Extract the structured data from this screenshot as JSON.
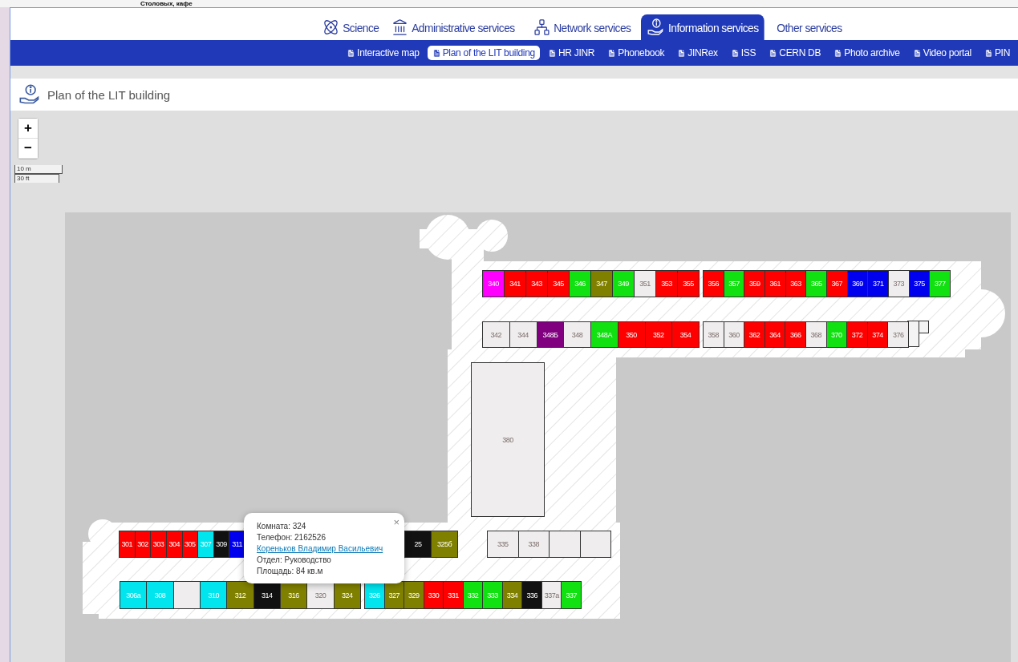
{
  "background": {
    "text": "Столовых, кафе"
  },
  "tabs": [
    {
      "label": "Science",
      "kind": "atom",
      "selected": false
    },
    {
      "label": "Administrative services",
      "kind": "building",
      "selected": false
    },
    {
      "label": "Network services",
      "kind": "network",
      "selected": false
    },
    {
      "label": "Information services",
      "kind": "info",
      "selected": true
    },
    {
      "label": "Other services",
      "selected": false
    }
  ],
  "subnav": [
    {
      "label": "Interactive map",
      "selected": false
    },
    {
      "label": "Plan of the LIT building",
      "selected": true
    },
    {
      "label": "HR JINR",
      "selected": false
    },
    {
      "label": "Phonebook",
      "selected": false
    },
    {
      "label": "JINRex",
      "selected": false
    },
    {
      "label": "ISS",
      "selected": false
    },
    {
      "label": "CERN DB",
      "selected": false
    },
    {
      "label": "Photo archive",
      "selected": false
    },
    {
      "label": "Video portal",
      "selected": false
    },
    {
      "label": "PIN",
      "selected": false
    }
  ],
  "page_title": "Plan of the LIT building",
  "map": {
    "zoom_in": "+",
    "zoom_out": "−",
    "scale": [
      "10 m",
      "30 ft"
    ],
    "blocks": [
      {
        "rooms": [
          {
            "label": "340",
            "color": "#ff00ff"
          },
          {
            "label": "341",
            "color": "#ff0000"
          },
          {
            "label": "343",
            "color": "#ff0000"
          },
          {
            "label": "345",
            "color": "#ff0000"
          },
          {
            "label": "346",
            "color": "#11e011"
          },
          {
            "label": "347",
            "color": "#808000"
          },
          {
            "label": "349",
            "color": "#11e011"
          },
          {
            "label": "351",
            "color": "#efeded"
          },
          {
            "label": "353",
            "color": "#ff0000"
          },
          {
            "label": "355",
            "color": "#ff0000"
          }
        ]
      },
      {
        "rooms": [
          {
            "label": "356",
            "color": "#ff0000"
          },
          {
            "label": "357",
            "color": "#11e011"
          },
          {
            "label": "359",
            "color": "#ff0000"
          },
          {
            "label": "361",
            "color": "#ff0000"
          },
          {
            "label": "363",
            "color": "#ff0000"
          },
          {
            "label": "365",
            "color": "#11e011"
          },
          {
            "label": "367",
            "color": "#ff0000"
          },
          {
            "label": "369",
            "color": "#0000ee"
          },
          {
            "label": "371",
            "color": "#0000ee"
          },
          {
            "label": "373",
            "color": "#efeded"
          },
          {
            "label": "375",
            "color": "#0000ee"
          },
          {
            "label": "377",
            "color": "#11e011"
          }
        ]
      },
      {
        "rooms": [
          {
            "label": "342",
            "color": "#efeded"
          },
          {
            "label": "344",
            "color": "#efeded"
          },
          {
            "label": "348Б",
            "color": "#800080"
          },
          {
            "label": "348",
            "color": "#efeded"
          },
          {
            "label": "348А",
            "color": "#11e011"
          },
          {
            "label": "350",
            "color": "#ff0000"
          },
          {
            "label": "352",
            "color": "#ff0000"
          },
          {
            "label": "354",
            "color": "#ff0000"
          }
        ]
      },
      {
        "rooms": [
          {
            "label": "358",
            "color": "#efeded"
          },
          {
            "label": "360",
            "color": "#efeded"
          },
          {
            "label": "362",
            "color": "#ff0000"
          },
          {
            "label": "364",
            "color": "#ff0000"
          },
          {
            "label": "366",
            "color": "#ff0000"
          },
          {
            "label": "368",
            "color": "#efeded"
          },
          {
            "label": "370",
            "color": "#11e011"
          },
          {
            "label": "372",
            "color": "#ff0000"
          },
          {
            "label": "374",
            "color": "#ff0000"
          },
          {
            "label": "376",
            "color": "#efeded"
          }
        ]
      },
      {
        "rooms": [
          {
            "label": "380",
            "color": "#efeded"
          }
        ]
      },
      {
        "rooms": [
          {
            "label": "301",
            "color": "#ff0000"
          },
          {
            "label": "302",
            "color": "#ff0000"
          },
          {
            "label": "303",
            "color": "#ff0000"
          },
          {
            "label": "304",
            "color": "#ff0000"
          },
          {
            "label": "305",
            "color": "#ff0000"
          },
          {
            "label": "307",
            "color": "#00e5ee"
          },
          {
            "label": "309",
            "color": "#111111"
          },
          {
            "label": "311",
            "color": "#0000ee"
          }
        ]
      },
      {
        "rooms": [
          {
            "label": "25",
            "color": "#111111"
          },
          {
            "label": "325б",
            "color": "#808000"
          }
        ]
      },
      {
        "rooms": [
          {
            "label": "335",
            "color": "#efeded"
          },
          {
            "label": "338",
            "color": "#efeded"
          },
          {
            "color": "#efeded"
          },
          {
            "color": "#efeded"
          }
        ]
      },
      {
        "rooms": [
          {
            "label": "306а",
            "color": "#00e5ee"
          },
          {
            "label": "308",
            "color": "#00e5ee"
          },
          {
            "color": "#efeded"
          },
          {
            "label": "310",
            "color": "#00e5ee"
          },
          {
            "label": "312",
            "color": "#808000"
          },
          {
            "label": "314",
            "color": "#111111"
          },
          {
            "label": "316",
            "color": "#808000"
          },
          {
            "label": "320",
            "color": "#efeded"
          },
          {
            "label": "324",
            "color": "#808000"
          }
        ]
      },
      {
        "rooms": [
          {
            "label": "326",
            "color": "#00e5ee"
          },
          {
            "label": "327",
            "color": "#808000"
          },
          {
            "label": "329",
            "color": "#808000"
          },
          {
            "label": "330",
            "color": "#ff0000"
          },
          {
            "label": "331",
            "color": "#ff0000"
          },
          {
            "label": "332",
            "color": "#11e011"
          },
          {
            "label": "333",
            "color": "#11e011"
          },
          {
            "label": "334",
            "color": "#808000"
          },
          {
            "label": "336",
            "color": "#111111"
          },
          {
            "label": "337а",
            "color": "#efeded"
          },
          {
            "label": "337",
            "color": "#11e011"
          }
        ]
      }
    ],
    "popup": {
      "close": "×",
      "lines": [
        "Комната: 324",
        "Телефон: 2162526"
      ],
      "link": "Кореньков Владимир Васильевич",
      "lines_after": [
        "Отдел: Руководство",
        "Площадь: 84 кв.м"
      ]
    }
  }
}
